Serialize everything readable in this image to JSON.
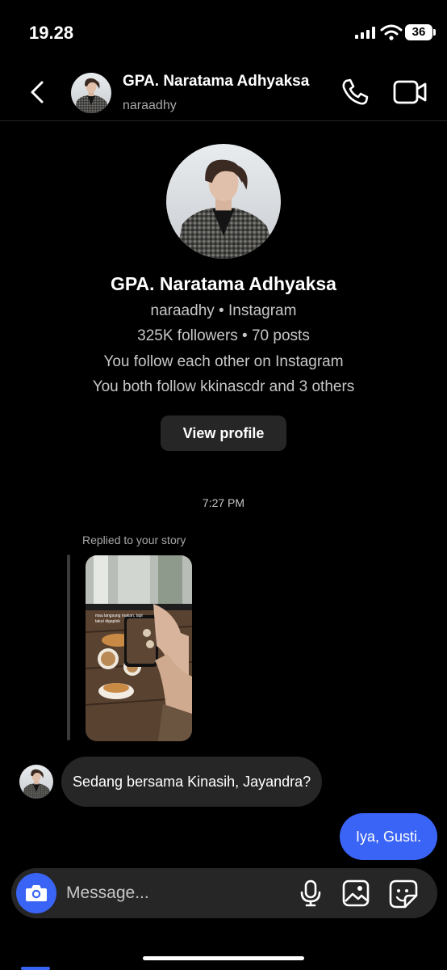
{
  "status_bar": {
    "time": "19.28",
    "battery": "36"
  },
  "header": {
    "back_icon": "chevron-left-icon",
    "name": "GPA. Naratama Adhyaksa",
    "username": "naraadhy",
    "call_icon": "phone-icon",
    "video_icon": "video-camera-icon"
  },
  "profile": {
    "name": "GPA. Naratama Adhyaksa",
    "username_line": "naraadhy • Instagram",
    "stats_line": "325K followers • 70 posts",
    "mutual_line": "You follow each other on Instagram",
    "common_line": "You both follow kkinascdr and 3 others",
    "view_profile_label": "View profile"
  },
  "conversation": {
    "timestamp": "7:27 PM",
    "reply_label": "Replied to your story",
    "story_caption": "mau langsung makan, tapi takut digaplok",
    "incoming_message": "Sedang bersama Kinasih, Jayandra?",
    "outgoing_message": "Iya, Gusti."
  },
  "composer": {
    "placeholder": "Message...",
    "camera_icon": "camera-icon",
    "mic_icon": "microphone-icon",
    "gallery_icon": "image-icon",
    "sticker_icon": "sticker-icon"
  },
  "colors": {
    "background": "#000000",
    "accent_blue": "#3a64f5",
    "bubble_gray": "#262626",
    "secondary_text": "#a8a8a8"
  }
}
